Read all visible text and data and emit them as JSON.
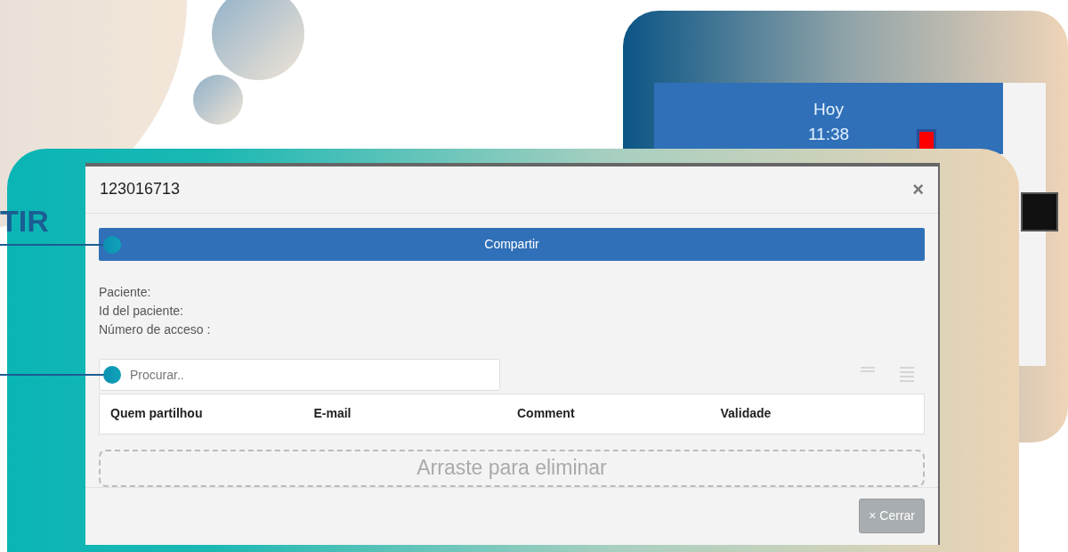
{
  "heading_fragment": "TIR",
  "background_window": {
    "day": "Hoy",
    "time": "11:38"
  },
  "dialog": {
    "title": "123016713",
    "close": "×",
    "share_bar": "Compartir",
    "info": [
      "Paciente:",
      "Id del paciente:",
      "Número de acceso :"
    ],
    "search": {
      "placeholder": "Procurar.."
    },
    "table": {
      "columns": [
        "Quem partilhou",
        "E-mail",
        "Comment",
        "Validade"
      ]
    },
    "dropzone": "Arraste para eliminar",
    "footer_button": {
      "icon": "×",
      "label": "Cerrar",
      "disabled": true
    }
  }
}
